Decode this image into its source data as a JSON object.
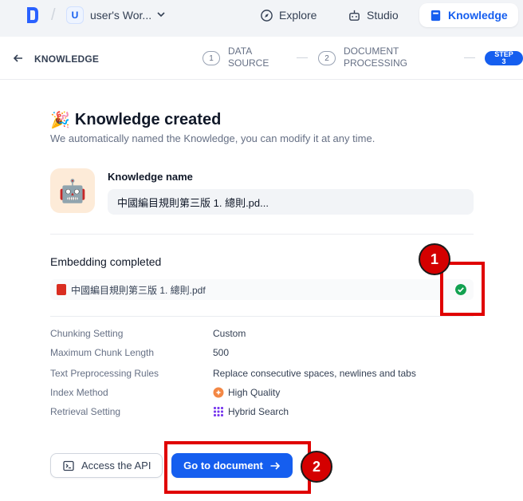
{
  "topnav": {
    "workspace_initial": "U",
    "workspace_name": "user's Wor...",
    "explore_label": "Explore",
    "studio_label": "Studio",
    "knowledge_label": "Knowledge"
  },
  "steps": {
    "back_title": "KNOWLEDGE",
    "step1_num": "1",
    "step1_label": "DATA SOURCE",
    "step2_num": "2",
    "step2_label": "DOCUMENT PROCESSING",
    "step3_label": "STEP 3"
  },
  "main": {
    "emoji": "🎉",
    "title": "Knowledge created",
    "subtitle": "We automatically named the Knowledge, you can modify it at any time.",
    "knowledge_icon": "🤖",
    "name_label": "Knowledge name",
    "name_value": "中國編目規則第三版 1. 總則.pd...",
    "embedding_title": "Embedding completed",
    "file_name": "中國編目規則第三版 1. 總則.pdf"
  },
  "settings": [
    {
      "label": "Chunking Setting",
      "value": "Custom"
    },
    {
      "label": "Maximum Chunk Length",
      "value": "500"
    },
    {
      "label": "Text Preprocessing Rules",
      "value": "Replace consecutive spaces, newlines and tabs"
    },
    {
      "label": "Index Method",
      "value": "High Quality"
    },
    {
      "label": "Retrieval Setting",
      "value": "Hybrid Search"
    }
  ],
  "actions": {
    "api_label": "Access the API",
    "doc_label": "Go to document"
  },
  "annotations": {
    "badge1": "1",
    "badge2": "2"
  },
  "colors": {
    "accent": "#155eef",
    "success": "#12a150",
    "annotation_red": "#e00000"
  }
}
